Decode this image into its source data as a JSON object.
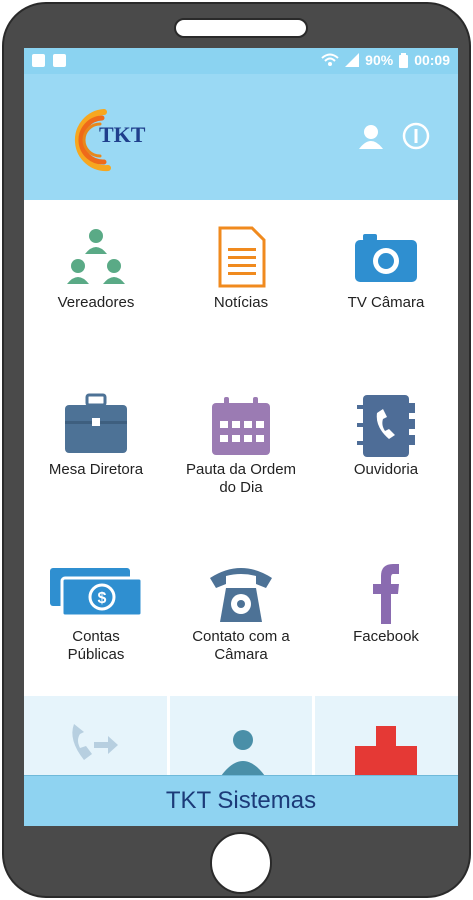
{
  "status_bar": {
    "battery": "90%",
    "time": "00:09"
  },
  "header": {
    "logo_text": "TKT"
  },
  "menu": [
    {
      "label": "Vereadores",
      "icon": "people-hierarchy-icon"
    },
    {
      "label": "Notícias",
      "icon": "document-icon"
    },
    {
      "label": "TV Câmara",
      "icon": "camera-icon"
    },
    {
      "label": "Mesa Diretora",
      "icon": "briefcase-icon"
    },
    {
      "label": "Pauta da Ordem do Dia",
      "icon": "calendar-icon"
    },
    {
      "label": "Ouvidoria",
      "icon": "phonebook-icon"
    },
    {
      "label": "Contas Públicas",
      "icon": "money-icon"
    },
    {
      "label": "Contato com a Câmara",
      "icon": "telephone-icon"
    },
    {
      "label": "Facebook",
      "icon": "facebook-icon"
    }
  ],
  "footer": {
    "title": "TKT Sistemas"
  },
  "colors": {
    "statusbar": "#8bd3f1",
    "appbar": "#9ad9f4",
    "footer": "#8fd3f1",
    "green": "#5aaa86",
    "orange": "#f08a1e",
    "blue": "#2f8fd0",
    "slate": "#4d7296",
    "purple": "#9b7bb3",
    "phonebook": "#4e6d97",
    "phone": "#4a4a4a"
  }
}
